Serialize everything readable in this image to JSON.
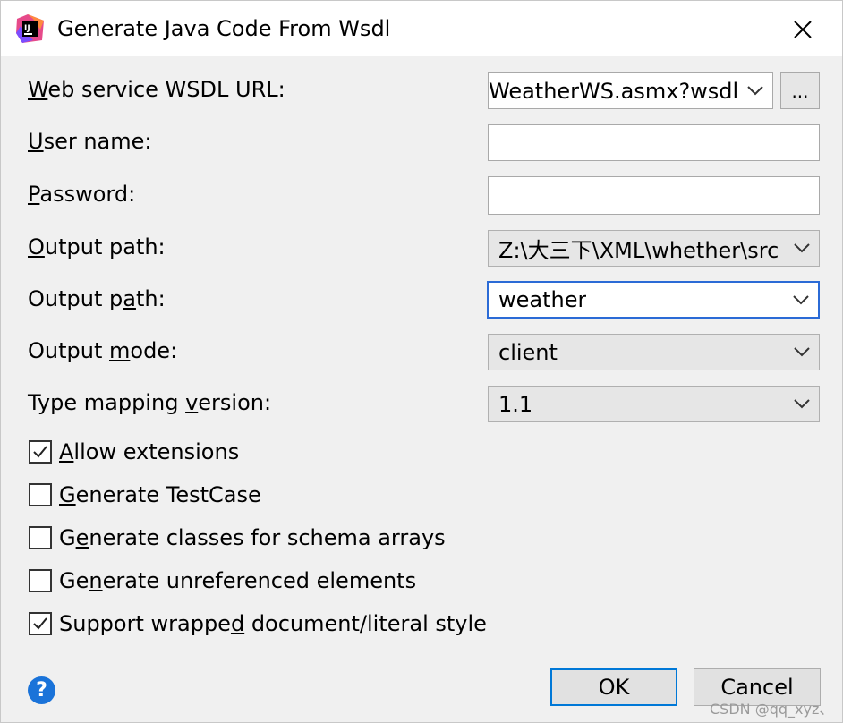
{
  "window": {
    "title": "Generate Java Code From Wsdl"
  },
  "form": {
    "wsdl_url": {
      "label_u": "W",
      "label_rest": "eb service WSDL URL:",
      "value": "WeatherWS.asmx?wsdl"
    },
    "browse_label": "...",
    "user_name": {
      "label_u": "U",
      "label_rest": "ser name:",
      "value": ""
    },
    "password": {
      "label_u": "P",
      "label_rest": "assword:",
      "value": ""
    },
    "output_path": {
      "label_u": "O",
      "label_rest": "utput path:",
      "value": "Z:\\大三下\\XML\\whether\\src"
    },
    "package": {
      "label_pre": "Output p",
      "label_u": "a",
      "label_post": "th:",
      "value": "weather"
    },
    "output_mode": {
      "label_pre": "Output ",
      "label_u": "m",
      "label_post": "ode:",
      "value": "client"
    },
    "type_mapping": {
      "label_pre": "Type mapping ",
      "label_u": "v",
      "label_post": "ersion:",
      "value": "1.1"
    }
  },
  "options": [
    {
      "pre": "",
      "u": "A",
      "post": "llow extensions",
      "checked": true
    },
    {
      "pre": "",
      "u": "G",
      "post": "enerate TestCase",
      "checked": false
    },
    {
      "pre": "G",
      "u": "e",
      "post": "nerate classes for schema arrays",
      "checked": false
    },
    {
      "pre": "Ge",
      "u": "n",
      "post": "erate unreferenced elements",
      "checked": false
    },
    {
      "pre": "Support wrappe",
      "u": "d",
      "post": " document/literal style",
      "checked": true
    }
  ],
  "buttons": {
    "ok": "OK",
    "cancel": "Cancel",
    "help": "?"
  },
  "watermark": "CSDN @qq_xyz、",
  "colors": {
    "focus": "#2b6bd6",
    "default_button": "#0078d7",
    "help": "#1a73d9"
  }
}
